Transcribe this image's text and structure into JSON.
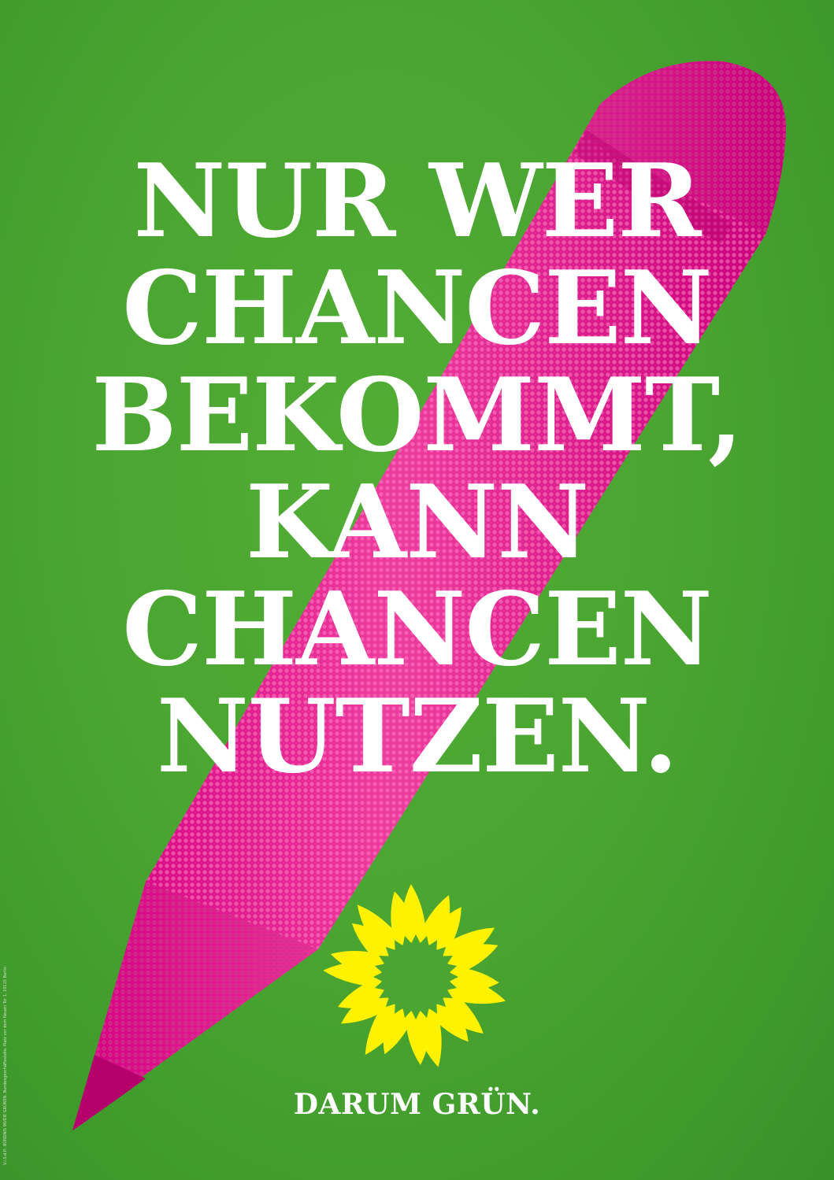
{
  "poster": {
    "headline": [
      "NUR WER",
      "CHANCEN",
      "BEKOMMT,",
      "KANN",
      "CHANCEN",
      "NUTZEN."
    ],
    "slogan": "DARUM GRÜN.",
    "imprint": "V.i.S.d.P.: BÜNDNIS 90/DIE GRÜNEN, Bundesgeschäftsstelle, Platz vor dem Neuen Tor 1, 10115 Berlin"
  },
  "colors": {
    "background": "#4aa531",
    "pencil_magenta": "#e6008a",
    "pencil_light": "#f15aab",
    "sunflower_yellow": "#fff200",
    "text": "#ffffff"
  },
  "icons": {
    "pencil": "pencil-icon",
    "sunflower": "sunflower-logo"
  }
}
